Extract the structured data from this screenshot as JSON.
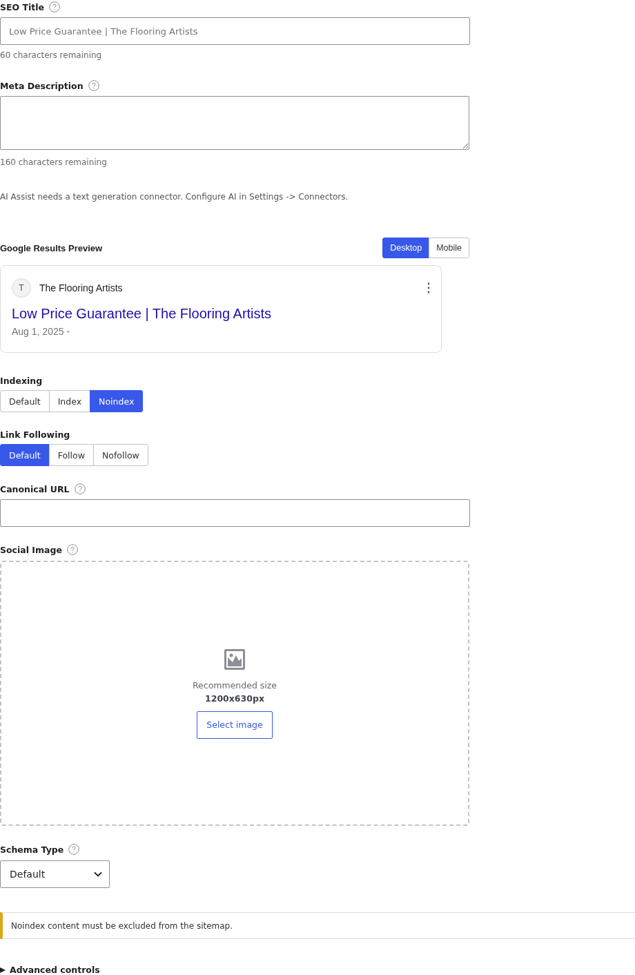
{
  "seo_title": {
    "label": "SEO Title",
    "placeholder": "Low Price Guarantee | The Flooring Artists",
    "helper": "60 characters remaining"
  },
  "meta_description": {
    "label": "Meta Description",
    "helper": "160 characters remaining"
  },
  "ai_notice": "AI Assist needs a text generation connector. Configure AI in Settings -> Connectors.",
  "preview": {
    "title": "Google Results Preview",
    "modes": [
      {
        "label": "Desktop",
        "selected": true
      },
      {
        "label": "Mobile",
        "selected": false
      }
    ],
    "avatar": "T",
    "site_name": "The Flooring Artists",
    "link": "Low Price Guarantee | The Flooring Artists",
    "date": "Aug 1, 2025 -"
  },
  "indexing": {
    "label": "Indexing",
    "options": [
      {
        "label": "Default",
        "selected": false
      },
      {
        "label": "Index",
        "selected": false
      },
      {
        "label": "Noindex",
        "selected": true
      }
    ]
  },
  "link_following": {
    "label": "Link Following",
    "options": [
      {
        "label": "Default",
        "selected": true
      },
      {
        "label": "Follow",
        "selected": false
      },
      {
        "label": "Nofollow",
        "selected": false
      }
    ]
  },
  "canonical_url": {
    "label": "Canonical URL"
  },
  "social_image": {
    "label": "Social Image",
    "hint": "Recommended size",
    "size": "1200x630px",
    "button": "Select image"
  },
  "schema_type": {
    "label": "Schema Type",
    "value": "Default"
  },
  "warning": "Noindex content must be excluded from the sitemap.",
  "advanced": {
    "label": "Advanced controls",
    "expanded": false
  }
}
